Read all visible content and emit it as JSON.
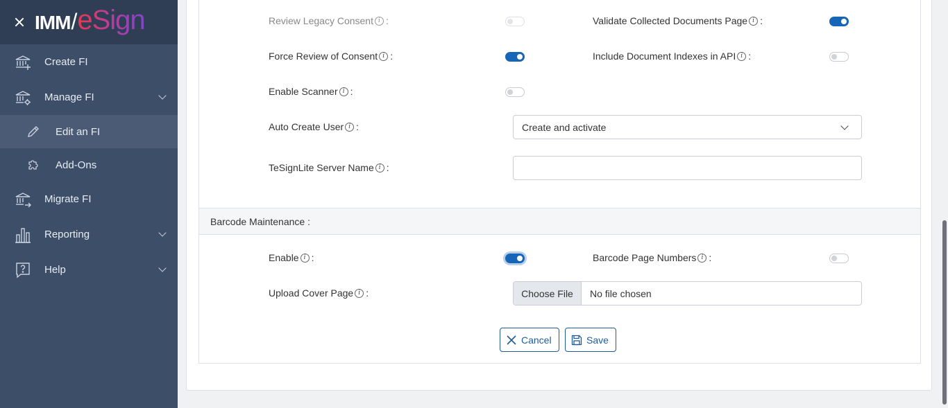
{
  "app": {
    "logo_left": "IMM",
    "logo_slash": "/",
    "logo_right": "eSign"
  },
  "sidebar": {
    "items": [
      {
        "label": "Create FI",
        "icon": "bank-plus-icon"
      },
      {
        "label": "Manage FI",
        "icon": "bank-gear-icon",
        "expandable": true
      },
      {
        "label": "Edit an FI",
        "icon": "pencil-icon",
        "sub": true,
        "active": true
      },
      {
        "label": "Add-Ons",
        "icon": "puzzle-icon",
        "sub": true
      },
      {
        "label": "Migrate FI",
        "icon": "bank-arrow-icon"
      },
      {
        "label": "Reporting",
        "icon": "bar-chart-icon",
        "expandable": true
      },
      {
        "label": "Help",
        "icon": "help-bubble-icon",
        "expandable": true
      }
    ]
  },
  "settings": {
    "review_legacy_consent": {
      "label": "Review Legacy Consent",
      "value": false,
      "disabled": true
    },
    "validate_collected_docs": {
      "label": "Validate Collected Documents Page",
      "value": true
    },
    "force_review_consent": {
      "label": "Force Review of Consent",
      "value": true
    },
    "include_doc_indexes": {
      "label": "Include Document Indexes in API",
      "value": false
    },
    "enable_scanner": {
      "label": "Enable Scanner",
      "value": false
    },
    "auto_create_user": {
      "label": "Auto Create User",
      "value": "Create and activate"
    },
    "tesignlite_server": {
      "label": "TeSignLite Server Name",
      "value": ""
    }
  },
  "barcode": {
    "section_title": "Barcode Maintenance :",
    "enable": {
      "label": "Enable",
      "value": true
    },
    "page_numbers": {
      "label": "Barcode Page Numbers",
      "value": false
    },
    "upload_cover": {
      "label": "Upload Cover Page",
      "button": "Choose File",
      "file": "No file chosen"
    }
  },
  "actions": {
    "cancel": "Cancel",
    "save": "Save"
  },
  "colors": {
    "accent": "#1765b6",
    "sidebar": "#3d4e69",
    "sidebar_header": "#2f3d55"
  }
}
